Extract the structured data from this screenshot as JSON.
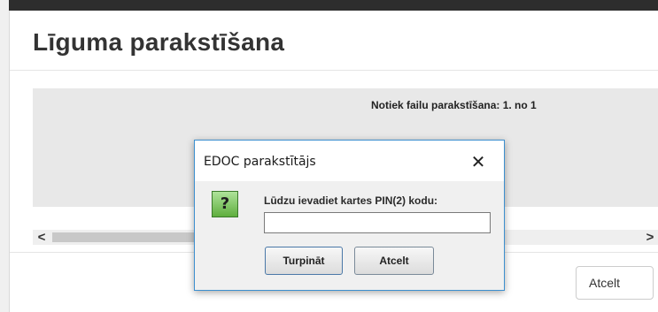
{
  "modal": {
    "title": "Līguma parakstīšana",
    "progress_text": "Notiek failu parakstīšana:  1. no 1",
    "cancel_label": "Atcelt",
    "scroll_left": "<",
    "scroll_right": ">"
  },
  "dialog": {
    "title": "EDOC parakstītājs",
    "close_glyph": "✕",
    "icon_glyph": "?",
    "prompt": "Lūdzu ievadiet kartes PIN(2) kodu:",
    "pin_value": "",
    "ok_label": "Turpināt",
    "cancel_label": "Atcelt"
  },
  "colors": {
    "dialog_border": "#3c8fcf",
    "icon_green": "#5fae3e"
  }
}
